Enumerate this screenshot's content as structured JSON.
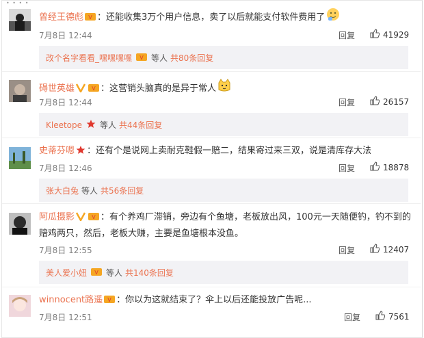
{
  "comments": [
    {
      "user": "曾经王德彪",
      "text": "：还能收集3万个用户信息，卖了以后就能支付软件费用了",
      "date": "7月8日 12:44",
      "reply_label": "回复",
      "likes": "41929",
      "sub": {
        "names": "改个名字看看_嘿嘿嘿嘿",
        "mid": "等人",
        "count": "共80条回复"
      }
    },
    {
      "user": "碍世英雄",
      "text": "：这营销头脑真的是异于常人",
      "date": "7月8日 12:44",
      "reply_label": "回复",
      "likes": "26157",
      "sub": {
        "names": "Kleetope",
        "mid": "等人",
        "count": "共44条回复"
      }
    },
    {
      "user": "史蒂芬嗯",
      "text": "：还有个是说网上卖耐克鞋假一赔二，结果寄过来三双，说是清库存大法",
      "date": "7月8日 12:46",
      "reply_label": "回复",
      "likes": "18878",
      "sub": {
        "names": "张大白兔",
        "mid": "等人",
        "count": "共56条回复"
      }
    },
    {
      "user": "阿瓜摄影",
      "text": "：有个养鸡厂滞销，旁边有个鱼塘，老板放出风，100元一天随便钓，钓不到的赔鸡两只，然后，老板大赚，主要是鱼塘根本没鱼。",
      "date": "7月8日 12:55",
      "reply_label": "回复",
      "likes": "12407",
      "sub": {
        "names": "美人爱小妞",
        "mid": "等人",
        "count": "共140条回复"
      }
    },
    {
      "user": "winnocent路遥",
      "text": "：你以为这就结束了？伞上以后还能投放广告呢...",
      "date": "7月8日 12:51",
      "reply_label": "回复",
      "likes": "7561"
    }
  ]
}
